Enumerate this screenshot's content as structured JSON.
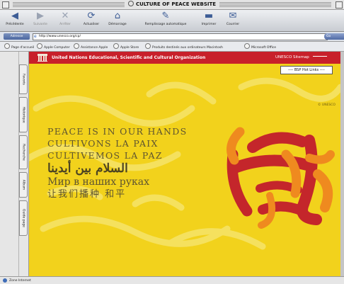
{
  "window": {
    "title": "CULTURE OF PEACE WEBSITE"
  },
  "toolbar": {
    "buttons": [
      {
        "label": "Précédente",
        "icon": "back-arrow-icon"
      },
      {
        "label": "Suivante",
        "icon": "forward-arrow-icon"
      },
      {
        "label": "Arrêter",
        "icon": "stop-icon"
      },
      {
        "label": "Actualiser",
        "icon": "refresh-icon"
      },
      {
        "label": "Démarrage",
        "icon": "home-icon"
      },
      {
        "label": "Remplissage automatique",
        "icon": "autofill-icon"
      },
      {
        "label": "Imprimer",
        "icon": "print-icon"
      },
      {
        "label": "Courrier",
        "icon": "mail-icon"
      }
    ]
  },
  "address": {
    "label": "Adresse",
    "url": "http://www.unesco.org/cp/",
    "go": "Go"
  },
  "favorites": [
    "Page d'accueil",
    "Apple Computer",
    "Assistance Apple",
    "Apple Store",
    "Produits destinés aux ordinateurs Macintosh",
    "Microsoft Office"
  ],
  "sidebar": {
    "tabs": [
      "Favoris",
      "Historique",
      "Recherche",
      "Album",
      "Guide page"
    ]
  },
  "page": {
    "org_name": "United Nations Educational, Scientific and Cultural Organization",
    "sitemap": "UNESCO Sitemap",
    "hot_links": "---- BSP Hot Links ----",
    "copyright": "© UNESCO",
    "lines": [
      "PEACE IS IN OUR HANDS",
      "CULTIVONS LA PAIX",
      "CULTIVEMOS LA PAZ",
      "السلام بين أيدينا",
      "Мир в наших руках",
      "让我们播种 和平"
    ]
  },
  "status": {
    "text": "Zone Internet"
  },
  "colors": {
    "background": "#f2d21c",
    "banner": "#c8202a",
    "text": "#5e5430",
    "art_red": "#c4262b",
    "art_orange": "#ef8a1f"
  }
}
